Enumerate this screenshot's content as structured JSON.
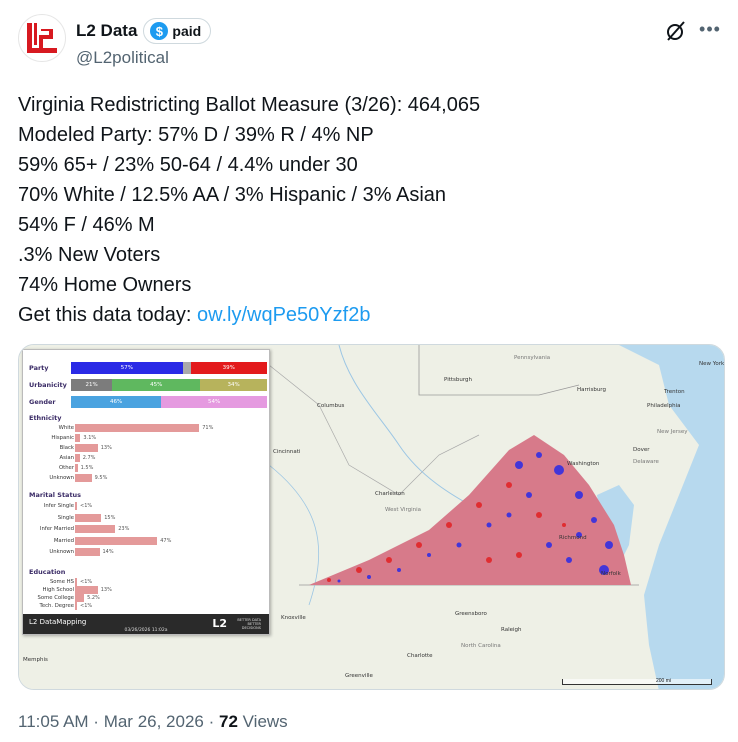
{
  "author": {
    "display_name": "L2 Data",
    "badge_label": "paid",
    "badge_icon": "dollar-icon",
    "handle": "@L2political",
    "avatar_icon": "l2-logo",
    "brand_color": "#d71920"
  },
  "tweet": {
    "lines": [
      "Virginia Redistricting Ballot Measure (3/26): 464,065",
      "Modeled Party: 57% D / 39% R / 4% NP",
      "59% 65+ / 23% 50-64 / 4.4% under 30",
      "70% White / 12.5% AA / 3% Hispanic / 3% Asian",
      "54% F / 46% M",
      ".3% New Voters",
      "74% Home Owners"
    ],
    "cta_text": "Get this data today: ",
    "link_text": "ow.ly/wqPe50Yzf2b"
  },
  "media": {
    "panel": {
      "party": {
        "label": "Party",
        "d_label": "57%",
        "d": 57,
        "np": 4,
        "r_label": "39%",
        "r": 39
      },
      "urbanicity": {
        "label": "Urbanicity",
        "a_label": "21%",
        "a": 21,
        "b_label": "45%",
        "b": 45,
        "c_label": "34%",
        "c": 34
      },
      "gender": {
        "label": "Gender",
        "m_label": "46%",
        "m": 46,
        "f_label": "54%",
        "f": 54
      },
      "ethnicity": {
        "title": "Ethnicity",
        "rows": [
          {
            "label": "White",
            "value": 71,
            "value_label": "71%"
          },
          {
            "label": "Hispanic",
            "value": 3.1,
            "value_label": "3.1%"
          },
          {
            "label": "Black",
            "value": 13,
            "value_label": "13%"
          },
          {
            "label": "Asian",
            "value": 2.7,
            "value_label": "2.7%"
          },
          {
            "label": "Other",
            "value": 1.5,
            "value_label": "1.5%"
          },
          {
            "label": "Unknown",
            "value": 9.5,
            "value_label": "9.5%"
          }
        ]
      },
      "marital": {
        "title": "Marital Status",
        "rows": [
          {
            "label": "Infer Single",
            "value": 1,
            "value_label": "<1%"
          },
          {
            "label": "Single",
            "value": 15,
            "value_label": "15%"
          },
          {
            "label": "Infer Married",
            "value": 23,
            "value_label": "23%"
          },
          {
            "label": "Married",
            "value": 47,
            "value_label": "47%"
          },
          {
            "label": "Unknown",
            "value": 14,
            "value_label": "14%"
          }
        ]
      },
      "education": {
        "title": "Education",
        "rows": [
          {
            "label": "Some HS",
            "value": 1,
            "value_label": "<1%"
          },
          {
            "label": "High School",
            "value": 13,
            "value_label": "13%"
          },
          {
            "label": "Some College",
            "value": 5.2,
            "value_label": "5.2%"
          },
          {
            "label": "Tech. Degree",
            "value": 1,
            "value_label": "<1%"
          }
        ]
      },
      "footer": {
        "left": "L2 DataMapping",
        "date": "03/26/2026 11:02a",
        "logo": "L2",
        "tagline": "BETTER DATA BETTER DECISIONS"
      }
    },
    "map_labels": [
      "New York",
      "Pennsylvania",
      "Pittsburgh",
      "Harrisburg",
      "Trenton",
      "Philadelphia",
      "New Jersey",
      "Columbus",
      "Dover",
      "Washington",
      "Charleston",
      "West Virginia",
      "Richmond",
      "Norfolk",
      "Knoxville",
      "Greensboro",
      "Raleigh",
      "North Carolina",
      "Charlotte",
      "Memphis",
      "Greenville",
      "Cincinnati",
      "Delaware"
    ],
    "scale_label": "200 mi",
    "colors": {
      "dem": "#2a2ae6",
      "rep": "#e31a1c",
      "np": "#aaaaaa",
      "urb_a": "#7c7c7c",
      "urb_b": "#5fb85f",
      "urb_c": "#b7b35c",
      "male": "#4aa3e0",
      "female": "#e59ae0",
      "bar": "#e49a9a"
    }
  },
  "meta": {
    "time": "11:05 AM",
    "date": "Mar 26, 2026",
    "views_count": "72",
    "views_label": "Views"
  }
}
